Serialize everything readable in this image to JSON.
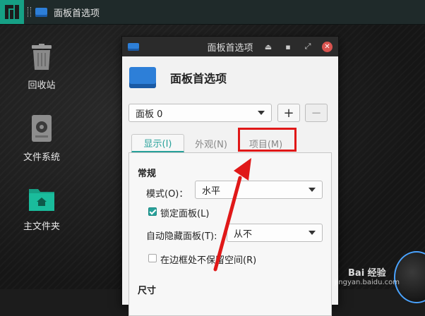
{
  "taskbar": {
    "task_label": "面板首选项"
  },
  "desktop_icons": [
    {
      "label": "回收站",
      "icon": "trash-icon"
    },
    {
      "label": "文件系统",
      "icon": "drive-icon"
    },
    {
      "label": "主文件夹",
      "icon": "home-folder-icon"
    }
  ],
  "window": {
    "title": "面板首选项",
    "header_title": "面板首选项",
    "panel_select": "面板 0",
    "add_button": "+",
    "remove_button": "−",
    "tabs": [
      {
        "label": "显示(I)",
        "active": true
      },
      {
        "label": "外观(N)",
        "active": false
      },
      {
        "label": "项目(M)",
        "active": false
      }
    ],
    "section_general": "常规",
    "mode_label": "模式(O)：",
    "mode_value": "水平",
    "lock_panel_label": "锁定面板(L)",
    "lock_panel_checked": true,
    "autohide_label": "自动隐藏面板(T):",
    "autohide_value": "从不",
    "reserve_space_label": "在边框处不保留空间(R)",
    "reserve_space_checked": false,
    "section_size": "尺寸"
  },
  "watermark": {
    "text": "Bai 经验",
    "sub": "jingyan.baidu.com"
  },
  "colors": {
    "accent": "#27a19a",
    "highlight_box": "#e01818",
    "arrow": "#e01818"
  }
}
